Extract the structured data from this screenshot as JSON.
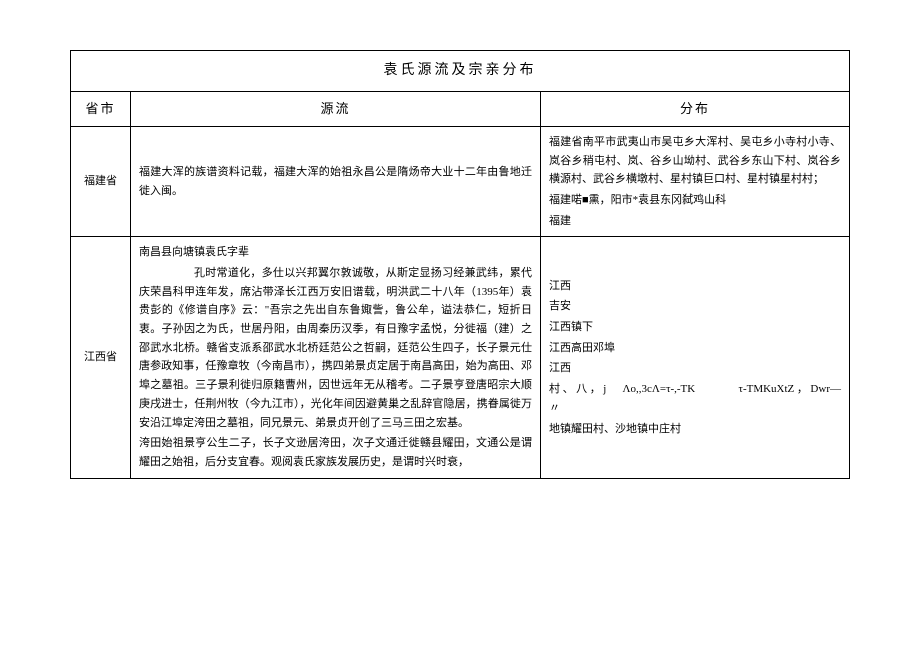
{
  "title": "袁氏源流及宗亲分布",
  "headers": {
    "province": "省市",
    "origin": "源流",
    "distribution": "分布"
  },
  "rows": [
    {
      "province": "福建省",
      "origin_paragraphs": [
        "福建大浑的族谱资料记载，福建大浑的始祖永昌公是隋炀帝大业十二年由鲁地迁徙入闽。"
      ],
      "distribution_paragraphs": [
        "福建省南平市武夷山市吴屯乡大浑村、吴屯乡小寺村小寺、岚谷乡稍屯村、岚、谷乡山坳村、武谷乡东山下村、岚谷乡横源村、武谷乡横墩村、星村镇巨口村、星村镇星村村；",
        "福建喏■熏，阳市*袁县东冈弑鸡山科",
        "福建"
      ]
    },
    {
      "province": "江西省",
      "origin_paragraphs": [
        "南昌县向塘镇袁氏字辈",
        "孔时常道化，多仕以兴邦翼尔敦诚敬，从斯定显扬习经兼武纬，累代庆荣昌科甲连年发，席沾带泽长江西万安旧谱载，明洪武二十八年（1395年）袁贵彭的《修谱自序》云：\"吾宗之先出自东鲁娵訾，鲁公牟，谥法恭仁，短折日衷。子孙因之为氏，世居丹阳，由周秦历汉季，有日豫字孟悦，分徙福（建）之邵武水北桥。赣省支派系邵武水北桥廷范公之哲嗣，廷范公生四子，长子景元仕唐参政知事，任豫章牧（今南昌市），携四弟景贞定居于南昌高田，始为高田、邓埠之墓祖。三子景利徙归原籍曹州，因世远年无从稽考。二子景亨登唐昭宗大顺庚戌进士，任荆州牧（今九江市），光化年间因避黄巢之乱辞官隐居，携眷属徙万安沿江埠定洿田之墓祖，同兄景元、弟景贞开创了三马三田之宏基。",
        "洿田始祖景亨公生二子，长子文逊居洿田，次子文通迁徙赣县耀田，文通公是谓耀田之始祖，后分支宜春。观阅袁氏家族发展历史，是谓时兴时衰，"
      ],
      "distribution_paragraphs": [
        "江西",
        "吉安",
        "江西镇下",
        "江西高田邓埠",
        "江西",
        "村、八，j　Λo,,3cΛ=τ-,-TK　　　τ-TMKuXtZ，Dwr—　　　　〃",
        "地镇耀田村、沙地镇中庄村"
      ]
    }
  ]
}
